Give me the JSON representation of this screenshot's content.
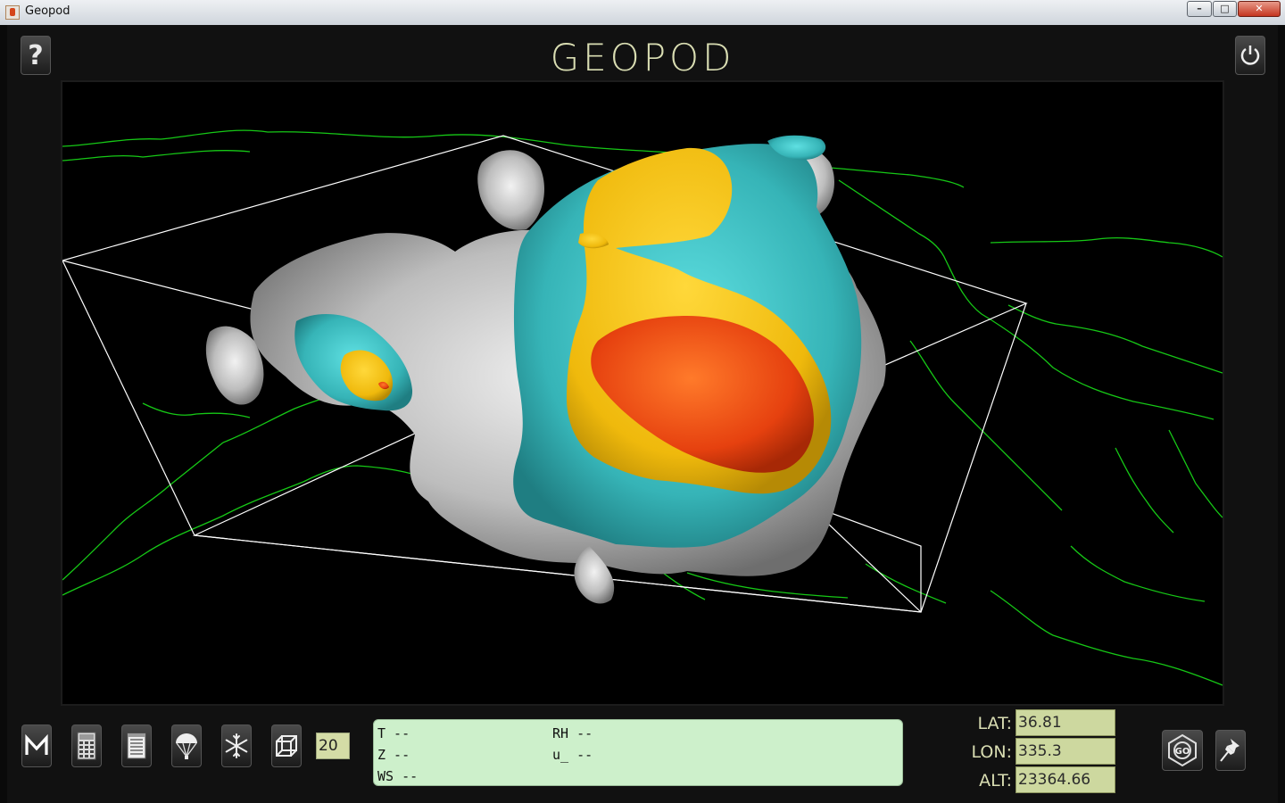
{
  "window": {
    "title": "Geopod",
    "minimize_label": "–",
    "maximize_label": "□",
    "close_label": "✕"
  },
  "header": {
    "logo": "GEOPOD",
    "help_label": "?"
  },
  "icons": [
    "help-icon",
    "power-icon",
    "m-icon",
    "calculator-icon",
    "notepad-icon",
    "parachute-icon",
    "snowflake-icon",
    "cube-icon",
    "go-target-icon",
    "pushpin-icon"
  ],
  "colors": {
    "background": "#0c0c0c",
    "accent_text": "#d9ddb2",
    "readout_bg": "#cdf0cb",
    "coord_field_bg": "#cdd89f",
    "map_lines": "#16c816",
    "isosurface_white": "#d6d6d6",
    "isosurface_cyan": "#3cc1c4",
    "isosurface_yellow": "#f2c21a",
    "isosurface_red": "#ff5a1c"
  },
  "toolbar": {
    "frame_count": "20"
  },
  "readout": {
    "t": "T --",
    "rh": "RH --",
    "z": "Z --",
    "u": "u_ --",
    "ws": "WS --"
  },
  "coords": {
    "lat_label": "LAT:",
    "lat_value": "36.81",
    "lon_label": "LON:",
    "lon_value": "335.3",
    "alt_label": "ALT:",
    "alt_value": "23364.66"
  },
  "go_label": "GO"
}
